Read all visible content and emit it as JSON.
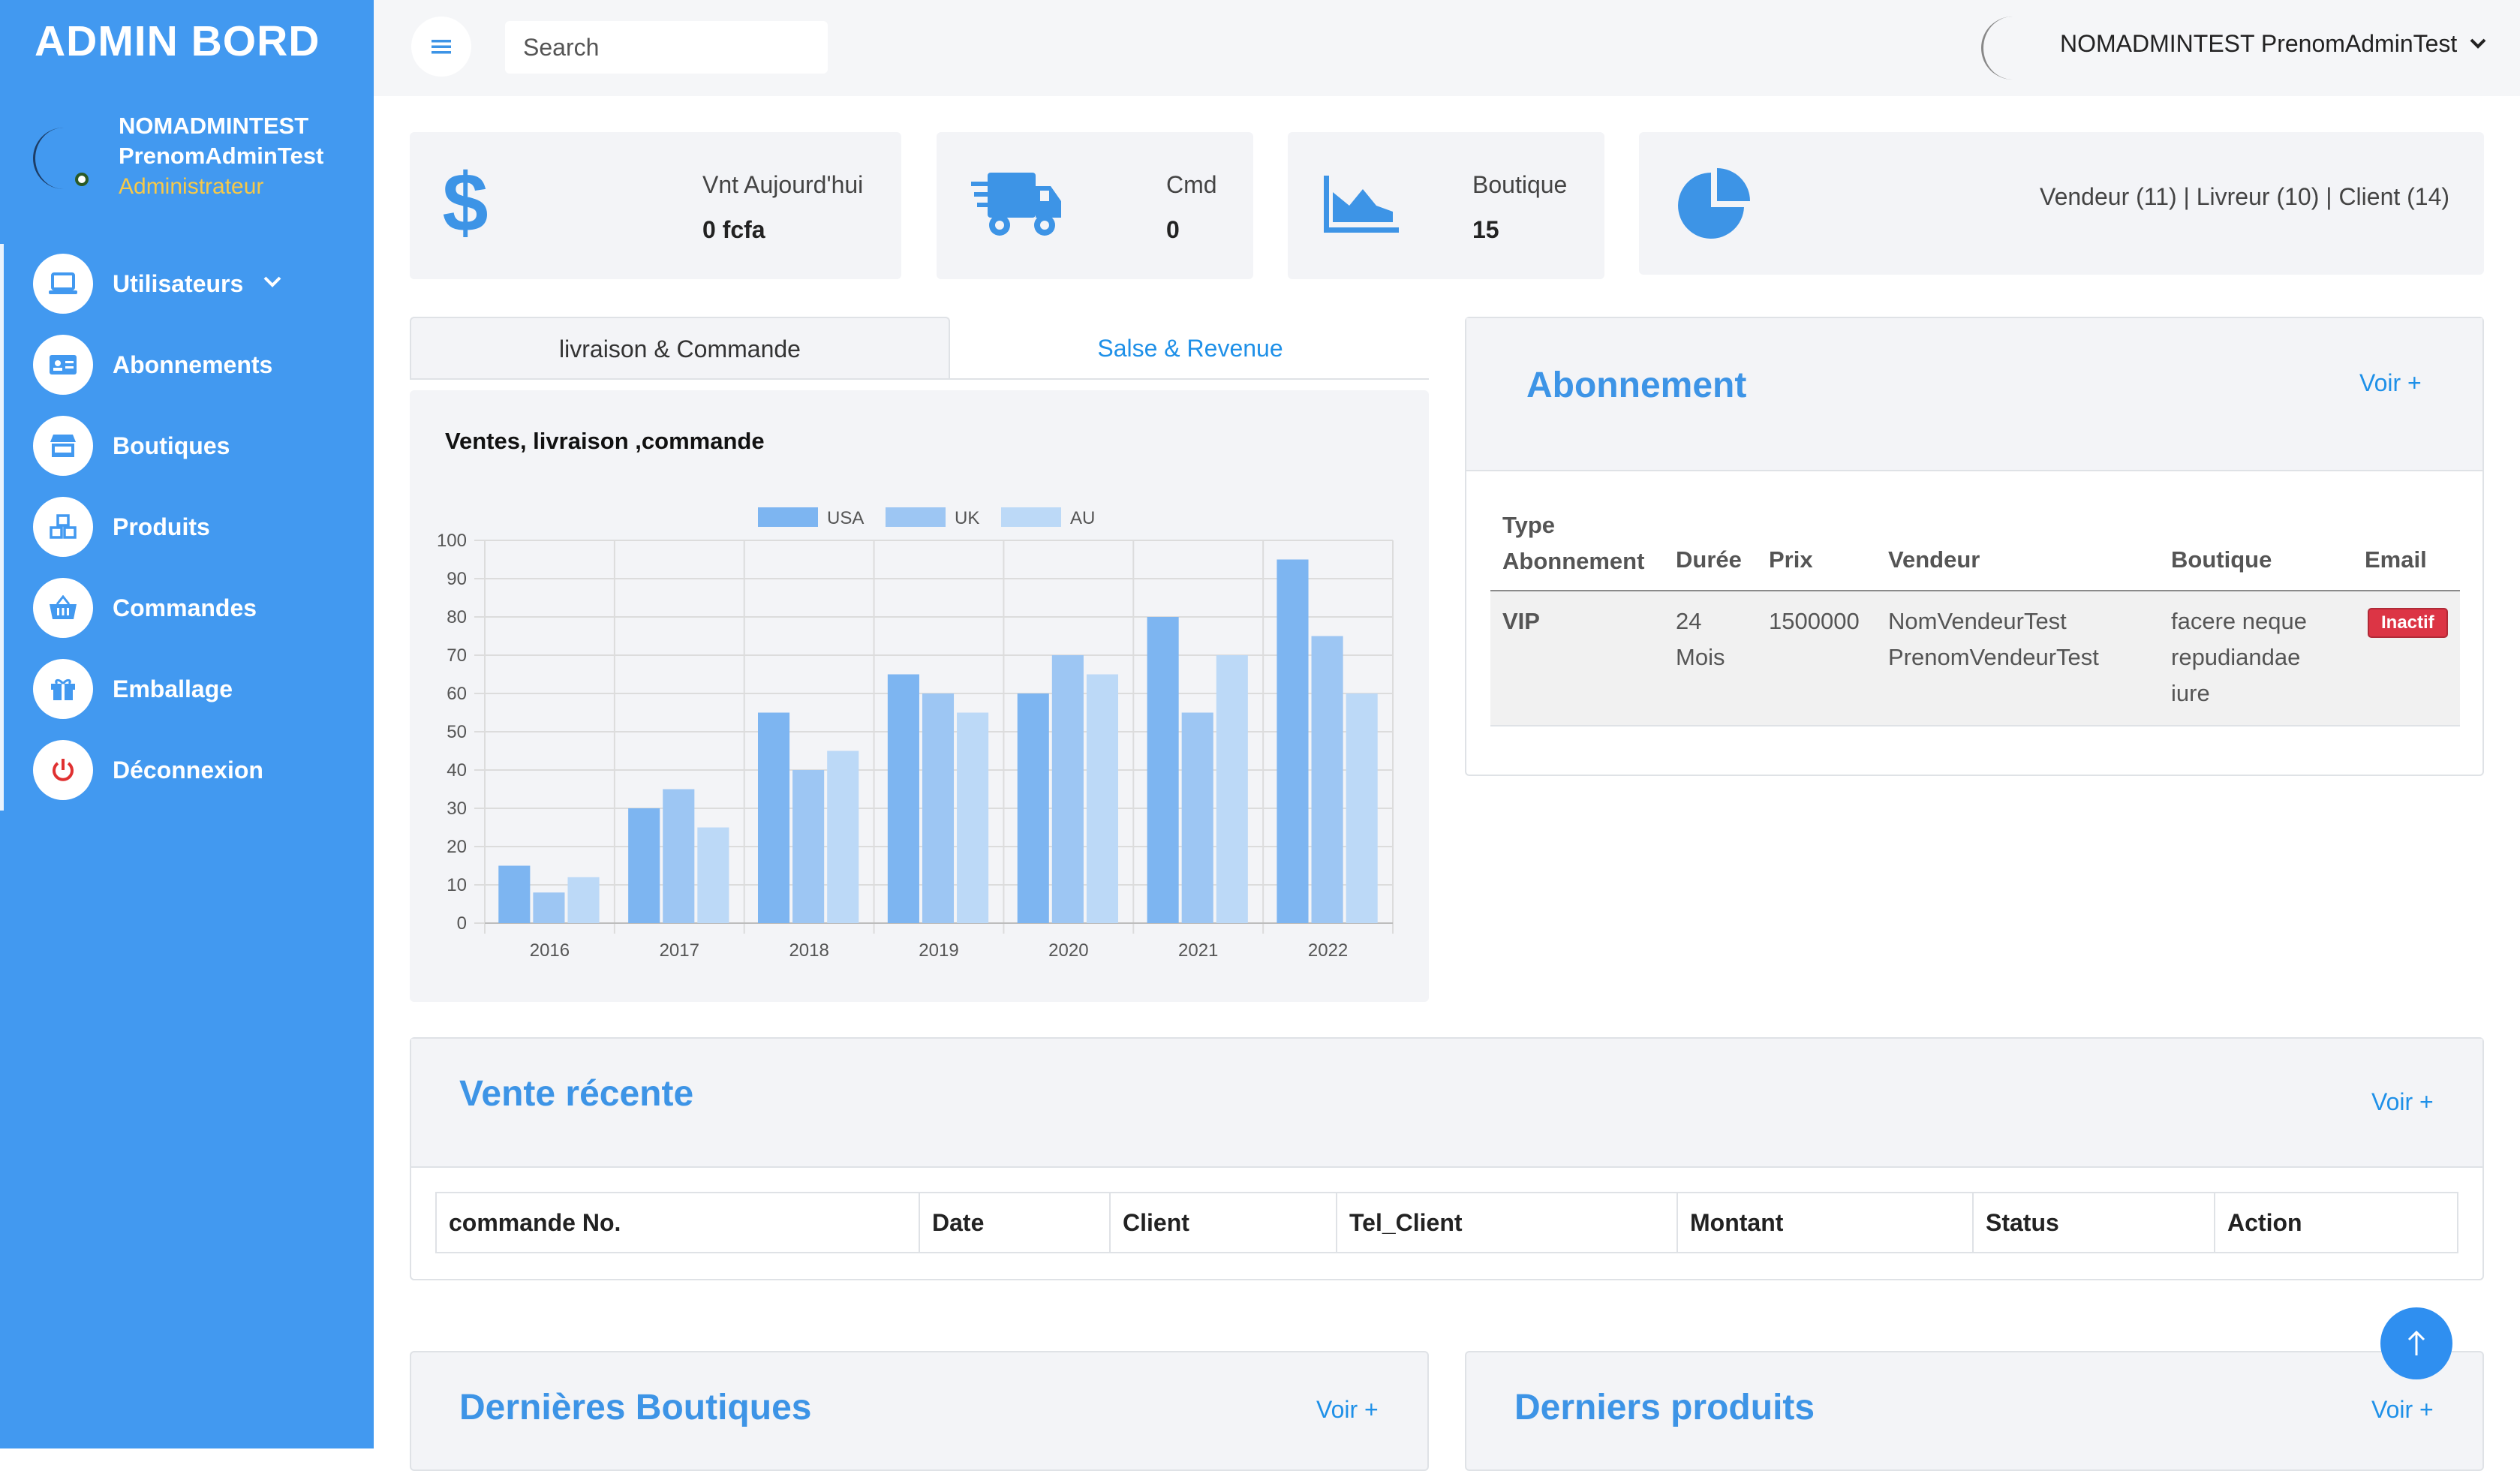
{
  "sidebar": {
    "brand": "ADMIN BORD",
    "profile": {
      "name": "NOMADMINTEST PrenomAdminTest",
      "role": "Administrateur"
    },
    "items": [
      {
        "label": "Utilisateurs",
        "icon": "laptop-icon",
        "has_submenu": true
      },
      {
        "label": "Abonnements",
        "icon": "id-card-icon"
      },
      {
        "label": "Boutiques",
        "icon": "store-icon"
      },
      {
        "label": "Produits",
        "icon": "cubes-icon"
      },
      {
        "label": "Commandes",
        "icon": "basket-icon"
      },
      {
        "label": "Emballage",
        "icon": "gift-icon"
      },
      {
        "label": "Déconnexion",
        "icon": "power-icon"
      }
    ]
  },
  "topbar": {
    "search_placeholder": "Search",
    "user_name": "NOMADMINTEST PrenomAdminTest"
  },
  "stats": [
    {
      "label": "Vnt Aujourd'hui",
      "value": "0 fcfa",
      "icon": "dollar-icon"
    },
    {
      "label": "Cmd",
      "value": "0",
      "icon": "truck-icon"
    },
    {
      "label": "Boutique",
      "value": "15",
      "icon": "area-chart-icon"
    },
    {
      "label": "Vendeur (11) | Livreur (10) | Client (14)",
      "icon": "pie-chart-icon"
    }
  ],
  "tabs": [
    "livraison & Commande",
    "Salse & Revenue"
  ],
  "chart_data": {
    "type": "bar",
    "title": "Ventes, livraison ,commande",
    "categories": [
      "2016",
      "2017",
      "2018",
      "2019",
      "2020",
      "2021",
      "2022"
    ],
    "series": [
      {
        "name": "USA",
        "values": [
          15,
          30,
          55,
          65,
          60,
          80,
          95
        ]
      },
      {
        "name": "UK",
        "values": [
          8,
          35,
          40,
          60,
          70,
          55,
          75
        ]
      },
      {
        "name": "AU",
        "values": [
          12,
          25,
          45,
          55,
          65,
          70,
          60
        ]
      }
    ],
    "ylim": [
      0,
      100
    ],
    "yticks": [
      "0",
      "10",
      "20",
      "30",
      "40",
      "50",
      "60",
      "70",
      "80",
      "90",
      "100"
    ],
    "legend": "top",
    "grid": true,
    "colors": [
      "#7db5f1",
      "#9dc6f3",
      "#bcd9f7"
    ]
  },
  "abonnement": {
    "title": "Abonnement",
    "voir": "Voir +",
    "headers": [
      "Type Abonnement",
      "Durée",
      "Prix",
      "Vendeur",
      "Boutique",
      "Email"
    ],
    "row": {
      "type": "VIP",
      "duree": "24 Mois",
      "prix": "1500000",
      "vendeur": "NomVendeurTest PrenomVendeurTest",
      "boutique": "facere neque repudiandae iure",
      "status": "Inactif"
    }
  },
  "vente_recente": {
    "title": "Vente récente",
    "voir": "Voir +",
    "headers": [
      "commande No.",
      "Date",
      "Client",
      "Tel_Client",
      "Montant",
      "Status",
      "Action"
    ]
  },
  "dernieres_boutiques": {
    "title": "Dernières Boutiques",
    "voir": "Voir +"
  },
  "derniers_produits": {
    "title": "Derniers produits",
    "voir": "Voir +"
  },
  "colors": {
    "primary": "#4299f0",
    "accent_title": "#3d94e6",
    "role": "#f7c948",
    "danger": "#dc3545"
  }
}
